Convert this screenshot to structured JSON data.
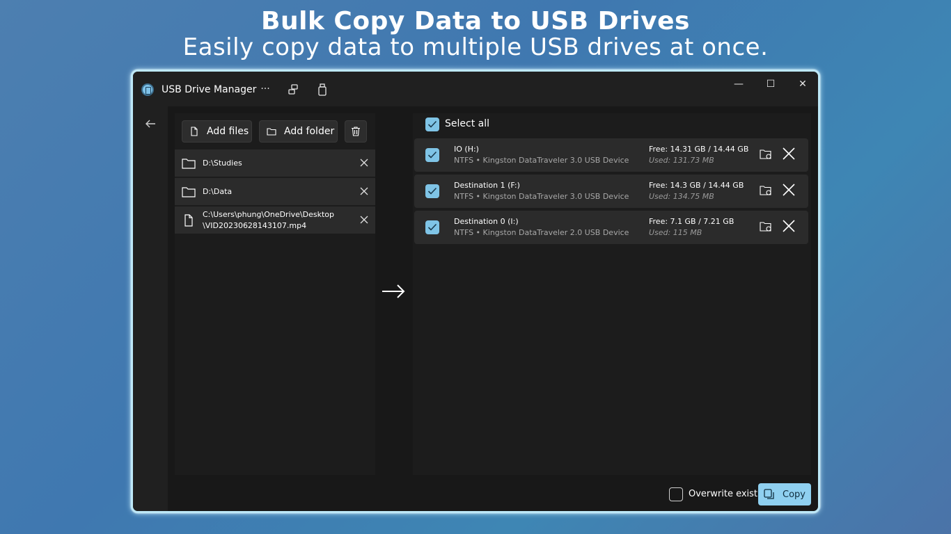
{
  "hero": {
    "title": "Bulk Copy Data to USB Drives",
    "subtitle": "Easily copy data to multiple USB drives at once."
  },
  "window": {
    "title": "USB Drive Manager",
    "controls": {
      "minimize": "—",
      "maximize": "☐",
      "close": "✕"
    },
    "toolbar": {
      "more": "···"
    }
  },
  "source": {
    "add_files_label": "Add files",
    "add_folder_label": "Add folder",
    "items": [
      {
        "type": "folder",
        "path": "D:\\Studies"
      },
      {
        "type": "folder",
        "path": "D:\\Data"
      },
      {
        "type": "file",
        "path_line1": "C:\\Users\\phung\\OneDrive\\Desktop",
        "path_line2": "\\VID20230628143107.mp4"
      }
    ]
  },
  "destinations": {
    "select_all_label": "Select all",
    "select_all_checked": true,
    "drives": [
      {
        "name": "IO (H:)",
        "details": "NTFS • Kingston DataTraveler 3.0 USB Device",
        "free": "Free: 14.31 GB / 14.44 GB",
        "used": "Used: 131.73 MB",
        "checked": true
      },
      {
        "name": "Destination 1 (F:)",
        "details": "NTFS • Kingston DataTraveler 3.0 USB Device",
        "free": "Free: 14.3 GB / 14.44 GB",
        "used": "Used: 134.75 MB",
        "checked": true
      },
      {
        "name": "Destination 0 (I:)",
        "details": "NTFS • Kingston DataTraveler 2.0 USB Device",
        "free": "Free: 7.1 GB / 7.21 GB",
        "used": "Used: 115 MB",
        "checked": true
      }
    ]
  },
  "footer": {
    "overwrite_label": "Overwrite existing files",
    "overwrite_checked": false,
    "copy_label": "Copy"
  },
  "colors": {
    "accent": "#7fc4e6",
    "window_bg": "#202020",
    "panel_bg": "#1c1c1c",
    "row_bg": "#2b2b2b",
    "glow_border": "#bde8f7"
  }
}
